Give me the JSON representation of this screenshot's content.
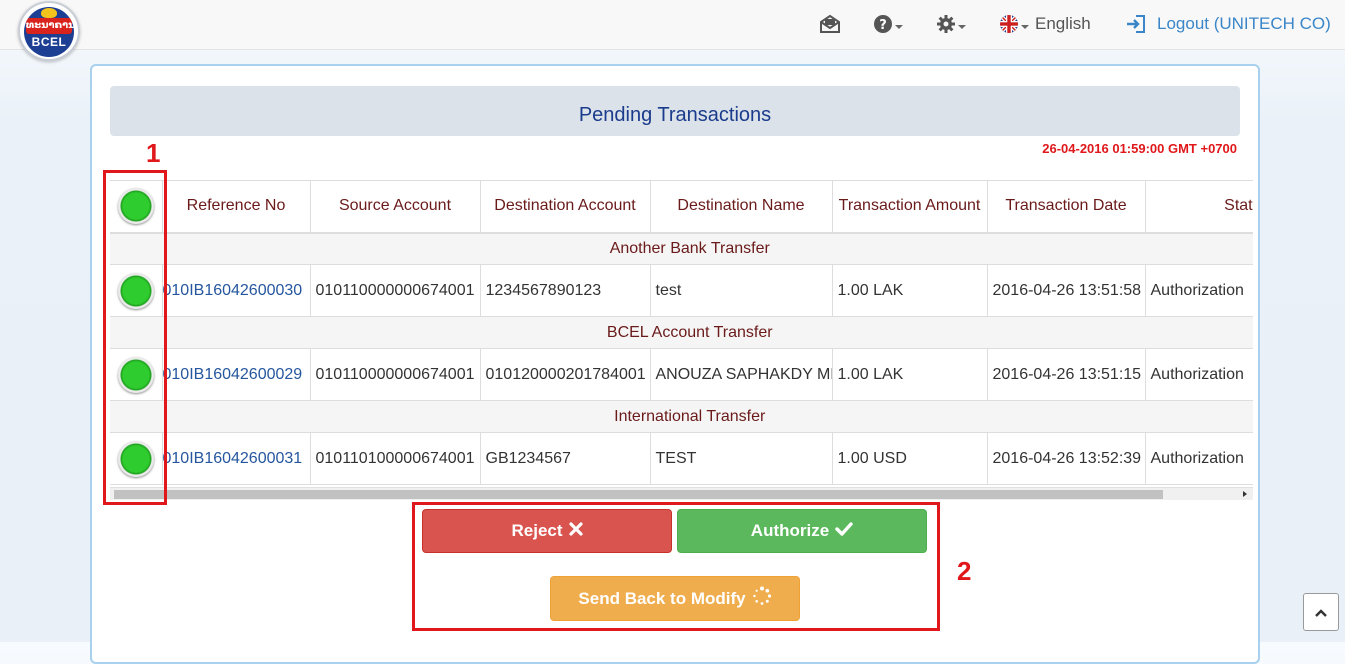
{
  "brand": {
    "logo_text": "BCEL",
    "logo_lao": "ທະນາຄານ"
  },
  "topbar": {
    "icons": [
      "envelope-icon",
      "help-icon",
      "gear-icon",
      "uk-flag-icon",
      "sign-in-icon"
    ],
    "language": "English",
    "logout_label": "Logout (UNITECH CO)",
    "logout_color": "#3a86c8"
  },
  "page": {
    "title": "Pending Transactions",
    "server_time": "26-04-2016 01:59:00 GMT +0700"
  },
  "callouts": {
    "left": "1",
    "right": "2"
  },
  "table": {
    "columns": [
      "",
      "Reference No",
      "Source Account",
      "Destination Account",
      "Destination Name",
      "Transaction Amount",
      "Transaction Date",
      "Status"
    ],
    "groups": [
      {
        "name": "Another Bank Transfer",
        "rows": [
          {
            "reference": "010IB16042600030",
            "source": "010110000000674001",
            "destination": "1234567890123",
            "name": "test",
            "amount": "1.00 LAK",
            "date": "2016-04-26 13:51:58",
            "status": "Authorization"
          }
        ]
      },
      {
        "name": "BCEL Account Transfer",
        "rows": [
          {
            "reference": "010IB16042600029",
            "source": "010110000000674001",
            "destination": "010120000201784001",
            "name": "ANOUZA SAPHAKDY MR",
            "amount": "1.00 LAK",
            "date": "2016-04-26 13:51:15",
            "status": "Authorization"
          }
        ]
      },
      {
        "name": "International Transfer",
        "rows": [
          {
            "reference": "010IB16042600031",
            "source": "010110100000674001",
            "destination": "GB1234567",
            "name": "TEST",
            "amount": "1.00 USD",
            "date": "2016-04-26 13:52:39",
            "status": "Authorization"
          }
        ]
      }
    ]
  },
  "actions": {
    "reject_label": "Reject",
    "authorize_label": "Authorize",
    "modify_label": "Send Back to Modify",
    "reject_color": "#d9534f",
    "authorize_color": "#5cb85c",
    "modify_color": "#f0ad4e"
  },
  "accent": {
    "callout_red": "#e0181b",
    "select_green": "#2ecc2e"
  }
}
